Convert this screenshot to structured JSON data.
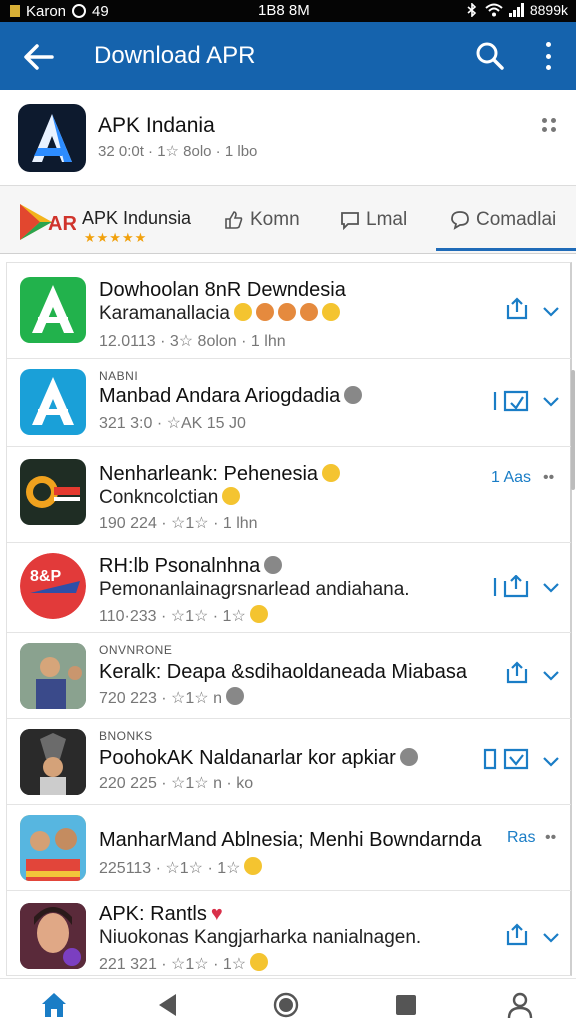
{
  "status_bar": {
    "carrier": "Karon",
    "left_extra": "49",
    "time": "1B8 8M",
    "battery": "8899k"
  },
  "app_bar": {
    "title": "Download APR"
  },
  "app_header": {
    "name": "APK Indania",
    "meta": "32 0:0t · 1☆ 8olo · 1 lbo"
  },
  "tabs_bar": {
    "brand_name": "APK Indunsia",
    "tabs": [
      "Komn",
      "Lmal",
      "Comadlai"
    ]
  },
  "list": [
    {
      "small": "",
      "title": "Dowhoolan 8nR Dewndesia",
      "sub": "Karamanallacia",
      "meta": "12.0113 · 3☆ 8olon · 1 lhn",
      "action": "",
      "icon": "apk-logo-green"
    },
    {
      "small": "NABNI",
      "title": "Manbad Andara Ariogdadia",
      "sub": "",
      "meta": "321 3:0 · ☆AK 15 J0",
      "action": "",
      "icon": "apk-logo-blue"
    },
    {
      "small": "",
      "title": "Nenharleank: Pehenesia",
      "sub": "Conkncolctian",
      "meta": "190 224 · ☆1☆ · 1 lhn",
      "action": "1 Aas",
      "icon": "game-icon"
    },
    {
      "small": "",
      "title": "RH:lb Psonalnhna",
      "sub": "Pemonanlainagrsnarlead andiahana.",
      "meta": "110·233 · ☆1☆ · 1☆",
      "action": "",
      "icon": "red-app-icon"
    },
    {
      "small": "ONVNRONE",
      "title": "Keralk: Deapa &sdihaoldaneada Miabasa",
      "sub": "",
      "meta": "720 223 · ☆1☆ n",
      "action": "",
      "icon": "photo-icon"
    },
    {
      "small": "BNONKS",
      "title": "PoohokAK Naldanarlar kor apkiar",
      "sub": "",
      "meta": "220 225 · ☆1☆ n · ko",
      "action": "",
      "icon": "movie-icon"
    },
    {
      "small": "",
      "title": "ManharMand Ablnesia; Menhi Bowndarnda",
      "sub": "",
      "meta": "225113 · ☆1☆ · 1☆",
      "action": "Ras",
      "icon": "group-icon"
    },
    {
      "small": "",
      "title": "APK: Rantls",
      "sub": "Niuokonas Kangjarharka nanialnagen.",
      "meta": "221 321 · ☆1☆ · 1☆",
      "action": "",
      "icon": "portrait-icon"
    }
  ],
  "colors": {
    "app_bar": "#1563ad",
    "accent": "#1a7dc6",
    "star": "#f1a10d"
  }
}
